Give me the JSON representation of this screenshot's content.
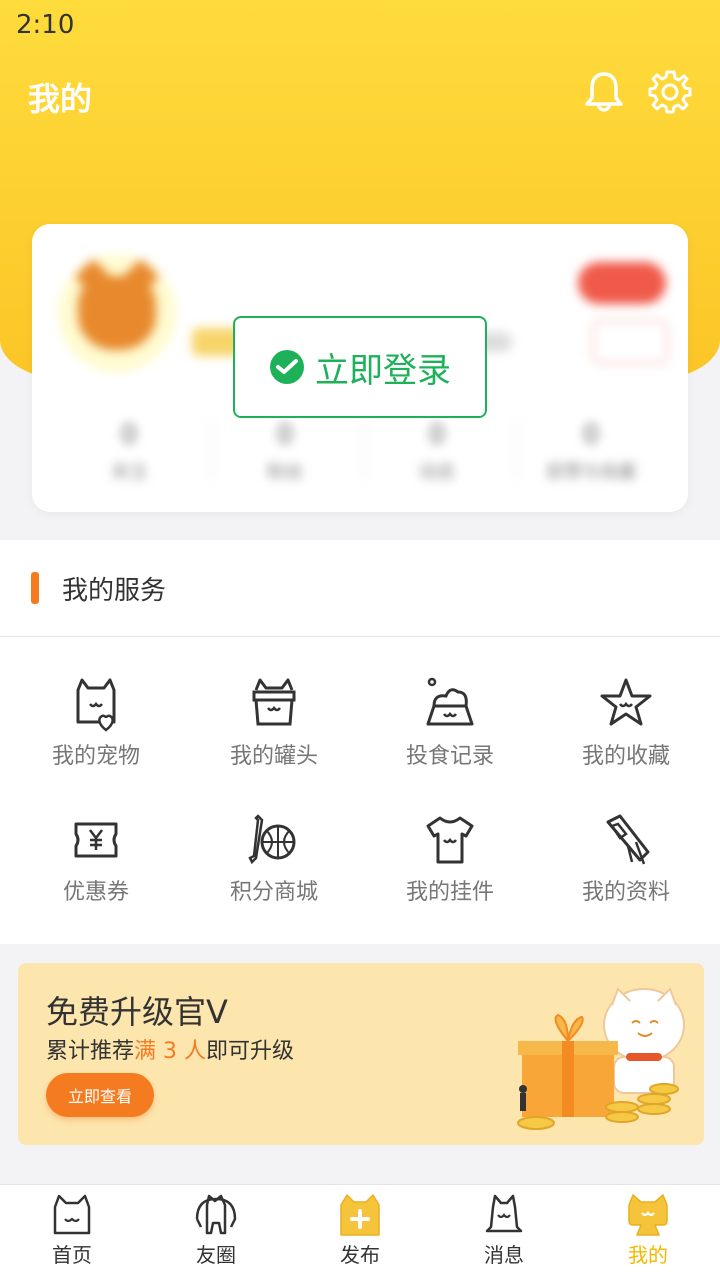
{
  "status": {
    "time": "2:10"
  },
  "header": {
    "title": "我的",
    "bell_icon": "bell-icon",
    "settings_icon": "gear-icon",
    "color": "#fdd335"
  },
  "login": {
    "label": "立即登录",
    "color": "#1fb15a",
    "icon": "wechat-icon"
  },
  "services": {
    "title": "我的服务",
    "items": [
      {
        "label": "我的宠物",
        "icon": "pet-heart-icon"
      },
      {
        "label": "我的罐头",
        "icon": "can-basket-icon"
      },
      {
        "label": "投食记录",
        "icon": "feed-bowl-icon"
      },
      {
        "label": "我的收藏",
        "icon": "star-icon"
      },
      {
        "label": "优惠券",
        "icon": "coupon-icon"
      },
      {
        "label": "积分商城",
        "icon": "ball-bone-icon"
      },
      {
        "label": "我的挂件",
        "icon": "tshirt-icon"
      },
      {
        "label": "我的资料",
        "icon": "id-tag-icon"
      }
    ]
  },
  "promo": {
    "title": "免费升级官V",
    "sub_prefix": "累计推荐",
    "sub_highlight": "满 3 人",
    "sub_suffix": "即可升级",
    "button": "立即查看",
    "accent": "#f47b20"
  },
  "tabs": [
    {
      "label": "首页",
      "icon": "cat-home-icon",
      "active": false
    },
    {
      "label": "友圈",
      "icon": "cat-circle-icon",
      "active": false
    },
    {
      "label": "发布",
      "icon": "add-post-icon",
      "active": false
    },
    {
      "label": "消息",
      "icon": "cat-bell-icon",
      "active": false
    },
    {
      "label": "我的",
      "icon": "cat-profile-icon",
      "active": true
    }
  ]
}
